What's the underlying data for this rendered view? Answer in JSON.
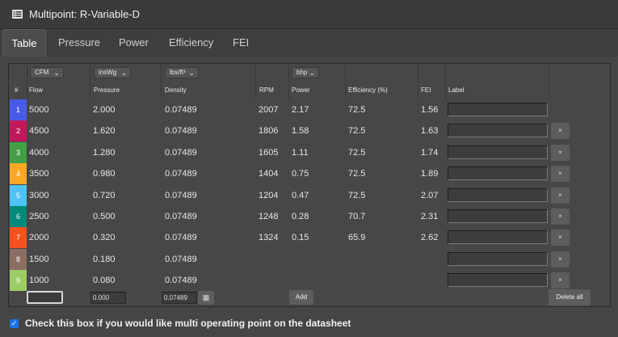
{
  "window": {
    "title": "Multipoint: R-Variable-D"
  },
  "tabs": [
    {
      "label": "Table",
      "active": true
    },
    {
      "label": "Pressure"
    },
    {
      "label": "Power"
    },
    {
      "label": "Efficiency"
    },
    {
      "label": "FEI"
    }
  ],
  "units": {
    "flow": "CFM",
    "pressure": "insWg",
    "density": "lbs/ft³",
    "power": "bhp"
  },
  "columns": {
    "index": "#",
    "flow": "Flow",
    "pressure": "Pressure",
    "density": "Density",
    "rpm": "RPM",
    "power": "Power",
    "efficiency": "Efficiency (%)",
    "fei": "FEI",
    "label": "Label"
  },
  "rows": [
    {
      "n": "1",
      "color": "#4a5ae8",
      "flow": "5000",
      "pressure": "2.000",
      "density": "0.07489",
      "rpm": "2007",
      "power": "2.17",
      "eff": "72.5",
      "fei": "1.56"
    },
    {
      "n": "2",
      "color": "#c2185b",
      "flow": "4500",
      "pressure": "1.620",
      "density": "0.07489",
      "rpm": "1806",
      "power": "1.58",
      "eff": "72.5",
      "fei": "1.63"
    },
    {
      "n": "3",
      "color": "#43a047",
      "flow": "4000",
      "pressure": "1.280",
      "density": "0.07489",
      "rpm": "1605",
      "power": "1.11",
      "eff": "72.5",
      "fei": "1.74"
    },
    {
      "n": "4",
      "color": "#f9a825",
      "flow": "3500",
      "pressure": "0.980",
      "density": "0.07489",
      "rpm": "1404",
      "power": "0.75",
      "eff": "72.5",
      "fei": "1.89"
    },
    {
      "n": "5",
      "color": "#4fc3f7",
      "flow": "3000",
      "pressure": "0.720",
      "density": "0.07489",
      "rpm": "1204",
      "power": "0.47",
      "eff": "72.5",
      "fei": "2.07"
    },
    {
      "n": "6",
      "color": "#00897b",
      "flow": "2500",
      "pressure": "0.500",
      "density": "0.07489",
      "rpm": "1248",
      "power": "0.28",
      "eff": "70.7",
      "fei": "2.31"
    },
    {
      "n": "7",
      "color": "#f4511e",
      "flow": "2000",
      "pressure": "0.320",
      "density": "0.07489",
      "rpm": "1324",
      "power": "0.15",
      "eff": "65.9",
      "fei": "2.62"
    },
    {
      "n": "8",
      "color": "#8d6e63",
      "flow": "1500",
      "pressure": "0.180",
      "density": "0.07489",
      "rpm": "",
      "power": "",
      "eff": "",
      "fei": ""
    },
    {
      "n": "9",
      "color": "#9ccc65",
      "flow": "1000",
      "pressure": "0.080",
      "density": "0.07489",
      "rpm": "",
      "power": "",
      "eff": "",
      "fei": ""
    }
  ],
  "entry": {
    "flow": "",
    "pressure": "0.000",
    "density": "0.07489",
    "add_label": "Add",
    "delete_all_label": "Delete all"
  },
  "delete_row_label": "×",
  "footer": {
    "checked": true,
    "text": "Check this box if you would like multi operating point on the datasheet"
  }
}
